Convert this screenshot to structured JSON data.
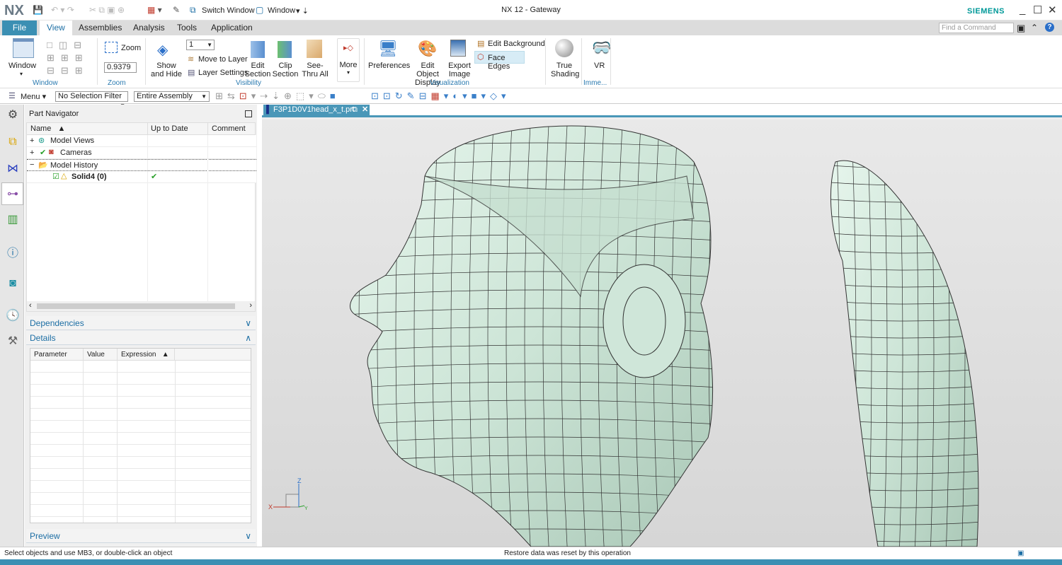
{
  "app": {
    "logo": "NX",
    "title": "NX 12 - Gateway",
    "brand": "SIEMENS",
    "switch_window": "Switch Window",
    "window_menu": "Window"
  },
  "tabs": [
    {
      "label": "File"
    },
    {
      "label": "View"
    },
    {
      "label": "Assemblies"
    },
    {
      "label": "Analysis"
    },
    {
      "label": "Tools"
    },
    {
      "label": "Application"
    }
  ],
  "search": {
    "placeholder": "Find a Command"
  },
  "ribbon": {
    "window": {
      "label": "Window",
      "group": "Window"
    },
    "zoom": {
      "label": "Zoom",
      "value": "0.9379",
      "group": "Zoom"
    },
    "visibility": {
      "show_hide": "Show and Hide",
      "layer_value": "1",
      "move_to_layer": "Move to Layer",
      "layer_settings": "Layer Settings",
      "edit_section": "Edit Section",
      "clip_section": "Clip Section",
      "see_thru": "See-Thru All",
      "more": "More",
      "group": "Visibility"
    },
    "visualization": {
      "preferences": "Preferences",
      "edit_object_display": "Edit Object Display",
      "export_image": "Export Image",
      "edit_background": "Edit Background",
      "face_edges": "Face Edges",
      "group": "Visualization"
    },
    "true_shading": "True Shading",
    "vr": "VR",
    "immersive_group": "Imme..."
  },
  "toolbar2": {
    "menu": "Menu",
    "selection_filter": "No Selection Filter",
    "scope": "Entire Assembly"
  },
  "navigator": {
    "title": "Part Navigator",
    "columns": [
      "Name",
      "Up to Date",
      "Comment"
    ],
    "rows": [
      {
        "name": "Model Views"
      },
      {
        "name": "Cameras"
      },
      {
        "name": "Model History"
      },
      {
        "name": "Solid4 (0)",
        "up_to_date": "✔"
      }
    ],
    "dependencies": "Dependencies",
    "details": "Details",
    "detail_columns": [
      "Parameter",
      "Value",
      "Expression"
    ],
    "preview": "Preview"
  },
  "viewport": {
    "file_tab": "F3P1D0V1head_x_t.prt",
    "axes": {
      "x": "X",
      "y": "Y",
      "z": "Z"
    }
  },
  "status": {
    "left": "Select objects and use MB3, or double-click an object",
    "center": "Restore data was reset by this operation"
  },
  "colors": {
    "accent": "#3b8fb3",
    "brand": "#009999",
    "model": "#d3e9dc"
  }
}
